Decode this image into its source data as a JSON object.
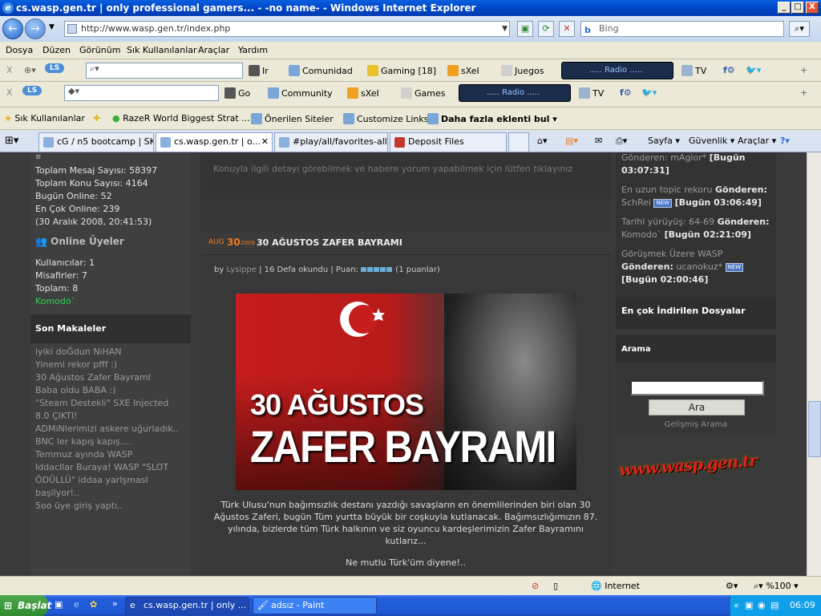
{
  "window": {
    "title": "cs.wasp.gen.tr | only professional gamers... - -no name- - Windows Internet Explorer",
    "btn_min": "_",
    "btn_max": "□",
    "btn_close": "X"
  },
  "address": {
    "url": "http://www.wasp.gen.tr/index.php",
    "search_placeholder": "Bing"
  },
  "menu": [
    "Dosya",
    "Düzen",
    "Görünüm",
    "Sık Kullanılanlar",
    "Araçlar",
    "Yardım"
  ],
  "toolbar1": {
    "close": "X",
    "ir": "Ir",
    "comunidad": "Comunidad",
    "gaming": "Gaming",
    "gaming_count": "[18]",
    "sxei": "sXeI",
    "juegos": "Juegos",
    "radio": "..... Radio .....",
    "tv": "TV"
  },
  "toolbar2": {
    "close": "X",
    "go": "Go",
    "community": "Community",
    "sxei": "sXeI",
    "games": "Games",
    "radio": "..... Radio .....",
    "tv": "TV"
  },
  "favorites": {
    "favorites_btn": "Sık Kullanılanlar",
    "items": [
      "RazeR World Biggest Strat ...",
      "Önerilen Siteler",
      "Customize Links",
      "Daha fazla eklenti bul"
    ]
  },
  "tabs": [
    "cG / n5 bootcamp | SK...",
    "cs.wasp.gen.tr | o...",
    "#play/all/favorites-all...",
    "Deposit Files"
  ],
  "commandbar": {
    "sayfa": "Sayfa",
    "guvenlik": "Güvenlik",
    "araclar": "Araçlar"
  },
  "left": {
    "stats": [
      "Toplam Mesaj Sayısı: 58397",
      "Toplam Konu Sayısı: 4164",
      "Bugün Online: 52",
      "En Çok Online: 239",
      "(30 Aralık 2008, 20:41:53)"
    ],
    "online_title": "Online Üyeler",
    "online": [
      "Kullanıcılar: 1",
      "Misafirler: 7",
      "Toplam: 8"
    ],
    "online_user": "Komodo`",
    "articles_title": "Son Makaleler",
    "articles": [
      "iyiki doĞdun NiHAN",
      "Yinemi rekor pfff :)",
      "30 Ağustos Zafer BayramI",
      "Baba oldu BABA :)",
      "\"Steam Destekli\" SXE Injected",
      "8.0 ÇIKTI!",
      "ADMiNlerimizi askere uğurladık..",
      "BNC ler kapış kapış....",
      "Temmuz ayında WASP",
      "IddacIlar Buraya! WASP \"SLOT",
      "ÖDÜLLÜ\" iddaa yarIşmasI",
      "başlIyor!..",
      "5oo üye giriş yaptı.."
    ]
  },
  "center": {
    "detail_text": "Konuyla ilgili detayı görebilmek ve habere yorum yapabilmek için lütfen tıklayınız",
    "date_month": "AUG",
    "date_day": "30",
    "date_year": "2009",
    "post_title": "30 AĞUSTOS ZAFER BAYRAMI",
    "meta_by": "by",
    "meta_author": "Lysippe",
    "meta_rest": "| 16 Defa okundu | Puan:",
    "meta_votes": "(1 puanlar)",
    "rating": 5,
    "banner_line1": "30 AĞUSTOS",
    "banner_line2": "ZAFER BAYRAMI",
    "body": "Türk Ulusu'nun bağımsızlık destanı yazdığı savaşların en önemlilerinden biri olan 30 Ağustos Zaferi, bugün Tüm yurtta büyük bir coşkuyla kutlanacak. Bağımsızlığımızın 87. yılında, bizlerde tüm Türk halkının ve siz  oyuncu kardeşlerimizin Zafer Bayramını kutlarız...",
    "closing": "Ne mutlu Türk'üm diyene!.."
  },
  "right": {
    "l1_label": "Gönderen:",
    "l1_user": "mAglor*",
    "l1_time": "[Bugün",
    "l1_time2": "03:07:31]",
    "l2_text": "En uzun topic rekoru",
    "l2_label": "Gönderen:",
    "l2_user": "SchRei",
    "l2_time": "[Bugün 03:06:49]",
    "l3_text": "Tarihi yürüyüş: 64-69",
    "l3_label": "Gönderen:",
    "l3_user": "Komodo`",
    "l3_time": "[Bugün 02:21:09]",
    "l4_text": "Görüşmek Üzere WASP",
    "l4_label": "Gönderen:",
    "l4_user": "ucanokuz*",
    "l4_time": "[Bugün 02:00:46]",
    "new_badge": "NEW",
    "downloads_title": "En çok İndirilen Dosyalar",
    "search_title": "Arama",
    "search_btn": "Ara",
    "adv_search": "Gelişmiş Arama",
    "logo": "www.wasp.gen.tr"
  },
  "status": {
    "zone": "Internet",
    "zoom": "%100"
  },
  "taskbar": {
    "start": "Başlat",
    "items": [
      "cs.wasp.gen.tr | only ...",
      "adsız - Paint"
    ],
    "clock": "06:09"
  }
}
